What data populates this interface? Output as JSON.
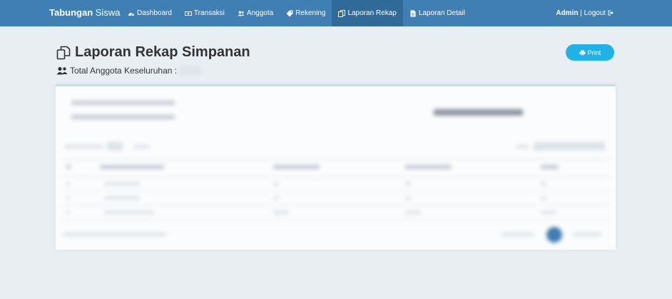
{
  "navbar": {
    "brand_bold": "Tabungan",
    "brand_light": "Siswa",
    "items": [
      {
        "label": "Dashboard",
        "icon": "dashboard-icon",
        "active": false
      },
      {
        "label": "Transaksi",
        "icon": "money-icon",
        "active": false
      },
      {
        "label": "Anggota",
        "icon": "users-icon",
        "active": false
      },
      {
        "label": "Rekening",
        "icon": "tag-icon",
        "active": false
      },
      {
        "label": "Laporan Rekap",
        "icon": "copy-icon",
        "active": true
      },
      {
        "label": "Laporan Detail",
        "icon": "file-icon",
        "active": false
      }
    ],
    "user": "Admin",
    "separator": "|",
    "logout": "Logout"
  },
  "page": {
    "title": "Laporan Rekap Simpanan",
    "subtitle": "Total Anggota Keseluruhan :",
    "print_label": "Print"
  },
  "colors": {
    "navbar": "#3f7fb3",
    "navbar_active": "#2f6a98",
    "print_button": "#1fb2e6",
    "background": "#e9eef3"
  }
}
